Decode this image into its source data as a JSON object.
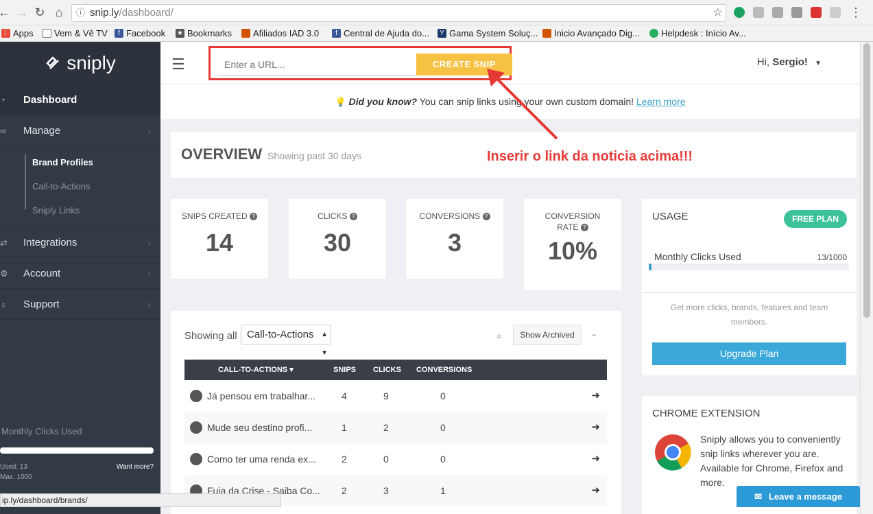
{
  "browser": {
    "url_host": "snip.ly",
    "url_path": "/dashboard/",
    "status_url": "ip.ly/dashboard/brands/"
  },
  "bookmarks": [
    "Apps",
    "Vem & Vê TV",
    "Facebook",
    "Bookmarks",
    "Afiliados IAD 3.0",
    "Central de Ajuda do...",
    "Gama System Soluç...",
    "Inicio Avançado Dig...",
    "Helpdesk : Início Av..."
  ],
  "sidebar": {
    "logo": "sniply",
    "items": {
      "dashboard": "Dashboard",
      "manage": "Manage",
      "brand_profiles": "Brand Profiles",
      "cta": "Call-to-Actions",
      "links": "Sniply Links",
      "integrations": "Integrations",
      "account": "Account",
      "support": "Support"
    },
    "usage_label": "Monthly Clicks Used",
    "used": "Used: 13",
    "max": "Max: 1000",
    "want_more": "Want more?"
  },
  "topbar": {
    "url_placeholder": "Enter a URL...",
    "create_btn": "CREATE SNIP",
    "greeting_prefix": "Hi, ",
    "user": "Sergio!"
  },
  "tip": {
    "label": "Did you know?",
    "text": " You can snip links using your own custom domain! ",
    "link": "Learn more"
  },
  "overview": {
    "title": "OVERVIEW",
    "subtitle": "Showing past 30 days",
    "annotation": "Inserir o link da noticia acima!!!"
  },
  "stats": {
    "snips_label": "SNIPS CREATED",
    "snips": "14",
    "clicks_label": "CLICKS",
    "clicks": "30",
    "conv_label": "CONVERSIONS",
    "conv": "3",
    "rate_label1": "CONVERSION",
    "rate_label2": "RATE",
    "rate": "10%"
  },
  "usage": {
    "title": "USAGE",
    "plan": "FREE PLAN",
    "label": "Monthly Clicks Used",
    "value": "13/1000",
    "fraction": 0.013,
    "more": "Get more clicks, brands, features and team members.",
    "upgrade": "Upgrade Plan"
  },
  "chrome_ext": {
    "title": "CHROME EXTENSION",
    "text": "Sniply allows you to conveniently snip links wherever you are. Available for Chrome, Firefox and more."
  },
  "cta_table": {
    "showing": "Showing all",
    "select": "Call-to-Actions",
    "archived": "Show Archived",
    "headers": {
      "name": "CALL-TO-ACTIONS ▾",
      "snips": "SNIPS",
      "clicks": "CLICKS",
      "conversions": "CONVERSIONS"
    },
    "rows": [
      {
        "name": "Já pensou em trabalhar...",
        "snips": "4",
        "clicks": "9",
        "conversions": "0"
      },
      {
        "name": "Mude seu destino profi...",
        "snips": "1",
        "clicks": "2",
        "conversions": "0"
      },
      {
        "name": "Como ter uma renda ex...",
        "snips": "2",
        "clicks": "0",
        "conversions": "0"
      },
      {
        "name": "Fuja da Crise - Saiba Co...",
        "snips": "2",
        "clicks": "3",
        "conversions": "1"
      }
    ]
  },
  "chat": "Leave a message",
  "colors": {
    "accent": "#f7c244",
    "brand": "#3aa8d8",
    "annotation": "#e53935",
    "plan": "#3cc29a"
  }
}
